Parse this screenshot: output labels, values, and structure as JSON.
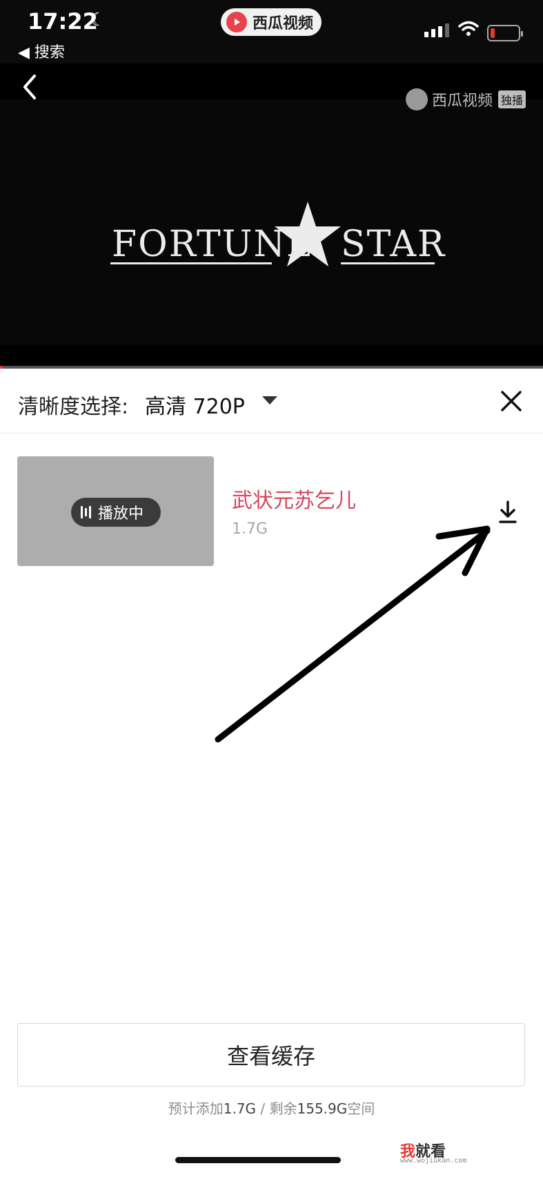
{
  "status_bar": {
    "time": "17:22",
    "back_app_label": "◀ 搜索",
    "app_pill_name": "西瓜视频"
  },
  "video": {
    "watermark_text": "西瓜视频",
    "watermark_badge": "独播",
    "logo_left": "FORTUNE",
    "logo_right": "STAR",
    "playback_progress": 0.005
  },
  "quality": {
    "label": "清晰度选择:",
    "value": "高清 720P"
  },
  "episode": {
    "playing_label": "播放中",
    "title": "武状元苏乞儿",
    "size": "1.7G"
  },
  "footer": {
    "view_cache_label": "查看缓存",
    "storage_prefix": "预计添加",
    "storage_added": "1.7G",
    "storage_sep": " / 剩余",
    "storage_remaining": "155.9G",
    "storage_suffix": "空间"
  },
  "site_watermark": {
    "name_accent": "我",
    "name_rest": "就看",
    "url": "www.wojiukan.com"
  },
  "colors": {
    "accent_red": "#e53935",
    "title_pink": "#d6455b",
    "thumbnail_gray": "#adadad"
  },
  "icons": [
    "moon-icon",
    "signal-icon",
    "wifi-icon",
    "battery-icon",
    "back-arrow-icon",
    "dropdown-caret-icon",
    "close-icon",
    "download-icon",
    "audio-bars-icon",
    "annotation-arrow"
  ]
}
